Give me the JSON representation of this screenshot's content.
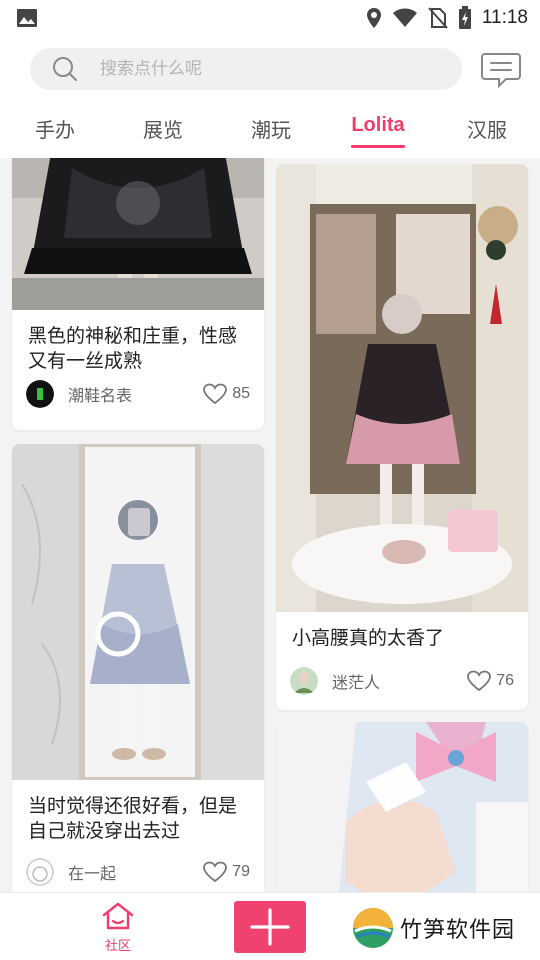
{
  "status_bar": {
    "time": "11:18",
    "icons": [
      "gallery-icon",
      "location-icon",
      "wifi-icon",
      "no-sim-icon",
      "battery-charging-icon"
    ]
  },
  "search": {
    "placeholder": "搜索点什么呢",
    "value": ""
  },
  "header": {
    "message_icon": "message-icon"
  },
  "tabs": [
    {
      "label": "手办",
      "active": false
    },
    {
      "label": "展览",
      "active": false
    },
    {
      "label": "潮玩",
      "active": false
    },
    {
      "label": "Lolita",
      "active": true
    },
    {
      "label": "汉服",
      "active": false
    }
  ],
  "feed": {
    "left": [
      {
        "title": "黑色的神秘和庄重，性感又有一丝成熟",
        "author": "潮鞋名表",
        "likes": "85"
      },
      {
        "title": "当时觉得还很好看，但是自己就没穿出去过",
        "author": "在一起",
        "likes": "79"
      }
    ],
    "right": [
      {
        "title": "小高腰真的太香了",
        "author": "迷茫人",
        "likes": "76"
      },
      {
        "title": "",
        "author": "",
        "likes": ""
      }
    ]
  },
  "bottom_nav": {
    "community_label": "社区",
    "post_icon": "plus-icon",
    "watermark_text": "竹笋软件园"
  },
  "colors": {
    "accent": "#f03d6c",
    "background": "#f3f3f3"
  }
}
